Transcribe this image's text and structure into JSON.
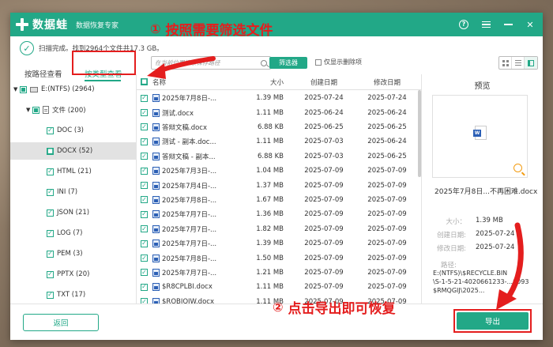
{
  "app": {
    "name": "数据蛙",
    "subtitle": "数据恢复专家"
  },
  "status": {
    "text": "扫描完成。找到2964个文件共17.3 GB。"
  },
  "annotations": {
    "step1_num": "①",
    "step1_text": "按照需要筛选文件",
    "step2_num": "②",
    "step2_text": "点击导出即可恢复",
    "color": "#e41e1e"
  },
  "tabs": {
    "by_path": "按路径查看",
    "by_type": "按类型查看"
  },
  "search": {
    "placeholder": "在当前位置搜索保存路径"
  },
  "filter_button": "筛选器",
  "only_deleted": "仅显示删除项",
  "tree": [
    {
      "label": "E:(NTFS) (2964)",
      "icon": "drive-icon",
      "state": "part",
      "caret": "▼"
    },
    {
      "label": "文件 (200)",
      "icon": "folder-icon",
      "state": "part",
      "caret": "▼"
    },
    {
      "label": "DOC (3)",
      "state": "chk"
    },
    {
      "label": "DOCX (52)",
      "state": "full",
      "selected": true
    },
    {
      "label": "HTML (21)",
      "state": "chk"
    },
    {
      "label": "INI (7)",
      "state": "chk"
    },
    {
      "label": "JSON (21)",
      "state": "chk"
    },
    {
      "label": "LOG (7)",
      "state": "chk"
    },
    {
      "label": "PEM (3)",
      "state": "chk"
    },
    {
      "label": "PPTX (20)",
      "state": "chk"
    },
    {
      "label": "TXT (17)",
      "state": "chk"
    }
  ],
  "columns": {
    "name": "名称",
    "size": "大小",
    "created": "创建日期",
    "modified": "修改日期"
  },
  "files": [
    {
      "name": "2025年7月8日-...",
      "size": "1.39 MB",
      "created": "2025-07-24",
      "modified": "2025-07-24"
    },
    {
      "name": "测试.docx",
      "size": "1.11 MB",
      "created": "2025-06-24",
      "modified": "2025-06-24"
    },
    {
      "name": "答辩文稿.docx",
      "size": "6.88 KB",
      "created": "2025-06-25",
      "modified": "2025-06-25"
    },
    {
      "name": "测试 - 副本.doc...",
      "size": "1.11 MB",
      "created": "2025-07-03",
      "modified": "2025-06-24"
    },
    {
      "name": "答辩文稿 - 副本...",
      "size": "6.88 KB",
      "created": "2025-07-03",
      "modified": "2025-06-25"
    },
    {
      "name": "2025年7月3日-...",
      "size": "1.04 MB",
      "created": "2025-07-09",
      "modified": "2025-07-09"
    },
    {
      "name": "2025年7月4日-...",
      "size": "1.37 MB",
      "created": "2025-07-09",
      "modified": "2025-07-09"
    },
    {
      "name": "2025年7月8日-...",
      "size": "1.67 MB",
      "created": "2025-07-09",
      "modified": "2025-07-09"
    },
    {
      "name": "2025年7月7日-...",
      "size": "1.36 MB",
      "created": "2025-07-09",
      "modified": "2025-07-09"
    },
    {
      "name": "2025年7月7日-...",
      "size": "1.82 MB",
      "created": "2025-07-09",
      "modified": "2025-07-09"
    },
    {
      "name": "2025年7月7日-...",
      "size": "1.39 MB",
      "created": "2025-07-09",
      "modified": "2025-07-09"
    },
    {
      "name": "2025年7月8日-...",
      "size": "1.50 MB",
      "created": "2025-07-09",
      "modified": "2025-07-09"
    },
    {
      "name": "2025年7月7日-...",
      "size": "1.21 MB",
      "created": "2025-07-09",
      "modified": "2025-07-09"
    },
    {
      "name": "$R8CPLBI.docx",
      "size": "1.11 MB",
      "created": "2025-07-09",
      "modified": "2025-07-09"
    },
    {
      "name": "$ROBIQIW.docx",
      "size": "1.11 MB",
      "created": "2025-07-09",
      "modified": "2025-07-09"
    }
  ],
  "preview": {
    "title": "预览",
    "file_name": "2025年7月8日...不再困难.docx",
    "size_label": "大小：",
    "size": "1.39 MB",
    "created_label": "创建日期:",
    "created": "2025-07-24",
    "modified_label": "修改日期:",
    "modified": "2025-07-24",
    "path_label": "路径:",
    "path_line1": "E:(NTFS)\\$RECYCLE.BIN",
    "path_line2": "\\S-1-5-21-4020661233-...0093",
    "path_line3": "$RMQGIJ\\2025..."
  },
  "buttons": {
    "back": "返回",
    "export": "导出"
  },
  "colors": {
    "accent": "#22a887",
    "annotation": "#e41e1e"
  }
}
